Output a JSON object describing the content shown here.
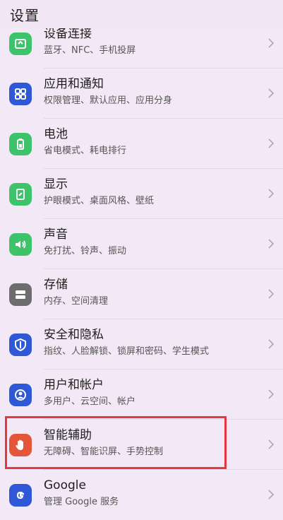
{
  "header": {
    "title": "设置"
  },
  "items": [
    {
      "label": "设备连接",
      "sub": "蓝牙、NFC、手机投屏",
      "icon": "device-connect-icon",
      "color": "#3dc46a"
    },
    {
      "label": "应用和通知",
      "sub": "权限管理、默认应用、应用分身",
      "icon": "apps-icon",
      "color": "#2f58d6"
    },
    {
      "label": "电池",
      "sub": "省电模式、耗电排行",
      "icon": "battery-icon",
      "color": "#3dc46a"
    },
    {
      "label": "显示",
      "sub": "护眼模式、桌面风格、壁纸",
      "icon": "display-icon",
      "color": "#3dc46a"
    },
    {
      "label": "声音",
      "sub": "免打扰、铃声、振动",
      "icon": "sound-icon",
      "color": "#3dc46a"
    },
    {
      "label": "存储",
      "sub": "内存、空间清理",
      "icon": "storage-icon",
      "color": "#6d6d6d"
    },
    {
      "label": "安全和隐私",
      "sub": "指纹、人脸解锁、锁屏和密码、学生模式",
      "icon": "security-shield-icon",
      "color": "#2f58d6"
    },
    {
      "label": "用户和帐户",
      "sub": "多用户、云空间、帐户",
      "icon": "user-account-icon",
      "color": "#2f58d6"
    },
    {
      "label": "智能辅助",
      "sub": "无障碍、智能识屏、手势控制",
      "icon": "hand-assist-icon",
      "color": "#e4553a"
    },
    {
      "label": "Google",
      "sub": "管理 Google 服务",
      "icon": "google-icon",
      "color": "#2f58d6"
    }
  ]
}
